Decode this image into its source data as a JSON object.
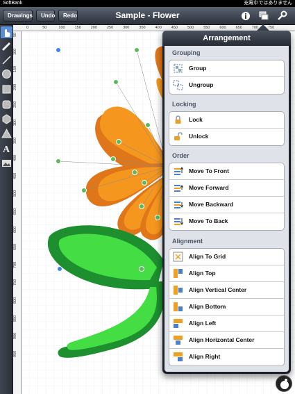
{
  "status": {
    "carrier": "SoftBank",
    "time": "",
    "charging": "充電中ではありません"
  },
  "toolbar": {
    "drawings": "Drawings",
    "undo": "Undo",
    "redo": "Redo",
    "title": "Sample - Flower",
    "icons": [
      "info-icon",
      "arrange-icon",
      "wrench-icon"
    ]
  },
  "tools": [
    "hand-pointer-icon",
    "pencil-icon",
    "line-icon",
    "circle-icon",
    "square-icon",
    "rounded-rect-icon",
    "hexagon-icon",
    "triangle-icon",
    "text-icon",
    "image-icon"
  ],
  "ruler": {
    "top": [
      "0",
      "50",
      "100",
      "150",
      "200",
      "250",
      "300",
      "350",
      "400",
      "450",
      "500",
      "550",
      "600",
      "650",
      "700",
      "750"
    ],
    "left": [
      "50",
      "100",
      "150",
      "200",
      "250",
      "300",
      "350",
      "400",
      "450",
      "500",
      "550",
      "600",
      "650",
      "700",
      "750",
      "800",
      "850",
      "900",
      "950"
    ]
  },
  "colors": {
    "petal": "#f5961e",
    "petal_dark": "#e0761a",
    "leaf": "#44dd44",
    "leaf_dark": "#1d8f2f",
    "grid": "#dde6ef",
    "accent": "#5a8fd6"
  },
  "popover": {
    "title": "Arrangement",
    "sections": [
      {
        "heading": "Grouping",
        "items": [
          {
            "label": "Group",
            "icon": "group-icon"
          },
          {
            "label": "Ungroup",
            "icon": "ungroup-icon"
          }
        ]
      },
      {
        "heading": "Locking",
        "items": [
          {
            "label": "Lock",
            "icon": "lock-icon"
          },
          {
            "label": "Unlock",
            "icon": "unlock-icon"
          }
        ]
      },
      {
        "heading": "Order",
        "items": [
          {
            "label": "Move To Front",
            "icon": "move-to-front-icon"
          },
          {
            "label": "Move Forward",
            "icon": "move-forward-icon"
          },
          {
            "label": "Move Backward",
            "icon": "move-backward-icon"
          },
          {
            "label": "Move To Back",
            "icon": "move-to-back-icon"
          }
        ]
      },
      {
        "heading": "Alignment",
        "items": [
          {
            "label": "Align To Grid",
            "icon": "align-to-grid-icon"
          },
          {
            "label": "Align Top",
            "icon": "align-top-icon"
          },
          {
            "label": "Align Vertical Center",
            "icon": "align-vertical-center-icon"
          },
          {
            "label": "Align Bottom",
            "icon": "align-bottom-icon"
          },
          {
            "label": "Align Left",
            "icon": "align-left-icon"
          },
          {
            "label": "Align Horizontal Center",
            "icon": "align-horizontal-center-icon"
          },
          {
            "label": "Align Right",
            "icon": "align-right-icon"
          }
        ]
      }
    ]
  }
}
